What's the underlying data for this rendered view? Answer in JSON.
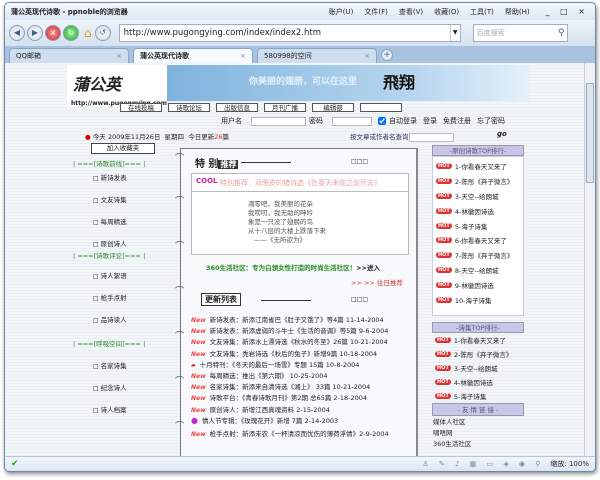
{
  "window": {
    "title": "蒲公英现代诗歌 - ppnoble的浏览器",
    "menu": [
      "账户(U)",
      "文件(F)",
      "查看(V)",
      "收藏(O)",
      "工具(T)",
      "帮助(H)"
    ],
    "controls": "_ □ ×"
  },
  "toolbar": {
    "url": "http://www.pugongying.com/index/index2.htm",
    "search_placeholder": "百度搜索"
  },
  "tabs": [
    {
      "label": "QQ邮箱"
    },
    {
      "label": "蒲公英现代诗歌"
    },
    {
      "label": "580998的空间"
    }
  ],
  "site": {
    "logo": "蒲公英",
    "logo_url": "http://www.pugongying.com",
    "slogan": "你美丽的翅膀，可以在这里",
    "fly": "飛翔",
    "nav": [
      "在线投稿",
      "诗歌论坛",
      "出版信息",
      "月刊广播",
      "编辑部",
      ""
    ],
    "login": {
      "username_label": "用户名",
      "password_label": "密码",
      "auto_login": "自动登录",
      "login": "登录",
      "register": "免费注册",
      "forgot": "忘了密码"
    },
    "date": {
      "today": "今天 2009年11月26日",
      "weekday": "星期四",
      "update_prefix": "今日更新",
      "update_count": "26",
      "update_suffix": "篇"
    },
    "query_label": "按文章或作者名查询",
    "go": "go"
  },
  "left": {
    "favorite": "加入收藏夹",
    "sections": [
      {
        "title": "| ===[诗歌前线]=== |",
        "items": [
          "新诗发表",
          "文友诗集",
          "每周精选",
          "原创诗人"
        ]
      },
      {
        "title": "| ===[诗歌评论]=== |",
        "items": [
          "诗人絮语",
          "枪手点射",
          "品诗读人"
        ]
      },
      {
        "title": "| ===[呼吸空间]=== |",
        "items": [
          "名家诗集",
          "纪念诗人",
          "诗人档案"
        ]
      }
    ]
  },
  "center": {
    "special_title": "特 别",
    "special_tag": "推荐",
    "more": "□□□",
    "cool": "COOL",
    "rec_title": "特别推荐：双眼皮的猪诗选《在春天来临之前死去》",
    "poem": [
      "凋零吧，我美丽的花朵",
      "我唠叨，我无助的呻吟",
      "象是一只没了翅膀的鸟",
      "从十八层的大楼上跌落下来",
      "——《无所欲为》"
    ],
    "ad": "360生活社区：专为白领女性打造的时尚生活社区！",
    "ad_enter": ">>进入",
    "past": ">> >> 往日推荐",
    "update_title": "更新列表",
    "new_badge": "New",
    "updates": [
      "新诗发表：新添江南雀巴《肚子又饿了》等4篇 11-14-2004",
      "新诗发表：新添虚弱的斗牛士《生活的音调》等5篇 9-6-2004",
      "文友诗集：新添水上漂诗选《秋水的冬至》26篇 10-21-2004",
      "文友诗集：秃岩诗选《秋后的兔子》新增9篇 10-18-2004",
      "十月特刊：《冬天的最后一场雪》专题 15篇 10-8-2004",
      "每周精选：推出《第六期》 10-25-2004",
      "名家诗集：新添来自清诗选《湘上》 33篇 10-21-2004",
      "诗歌平台：《青春诗歌月刊》第2期  总65篇 2-18-2004",
      "原创诗人：新增江西真魂资料 2-15-2004",
      "情人节专辑：《玫瑰花开》新增 7篇 2-14-2003",
      "枪手点射：新添未农《一杯清凉而忧伤的薄荷浮情》2-9-2004"
    ]
  },
  "right": {
    "hot": "HOT",
    "top_poems_title": "-原创诗歌TOP排行-",
    "top_poems": [
      "1-你看春天又来了",
      "2-陈彤《弃子微言》",
      "3-天空--给朗城",
      "4-林徽因诗选",
      "5-海子诗集",
      "6-你看春天又来了",
      "7-陈彤《弃子微言》",
      "8-天空--给朗城",
      "9-林徽因诗选",
      "10-海子诗集"
    ],
    "top_collections_title": "-诗集TOP排行-",
    "top_collections": [
      "1-你看春天又来了",
      "2-陈彤《弃子微言》",
      "3-天空--给朗城",
      "4-林徽因诗选",
      "5-海子诗集"
    ],
    "links_title": "- 友 情 链 接 -",
    "links": [
      "媒体人社区",
      "啸唔网",
      "360生活社区"
    ]
  },
  "status": {
    "zoom": "缩放: 100%"
  }
}
